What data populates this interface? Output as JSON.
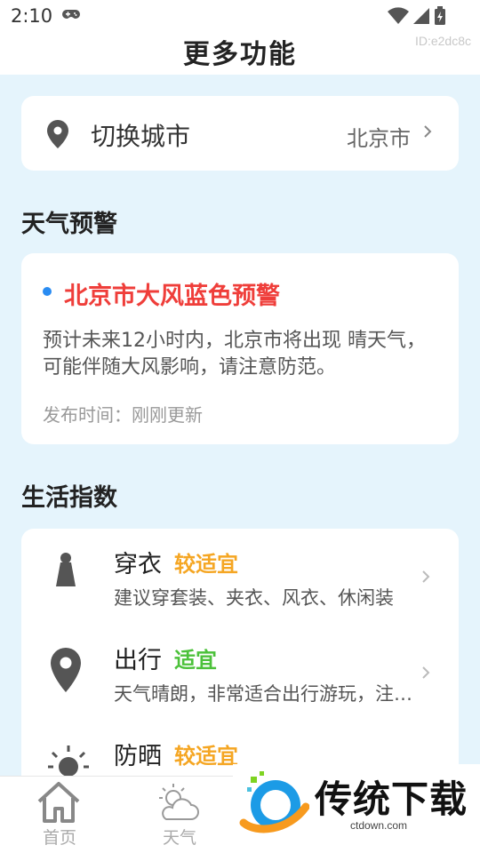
{
  "status_bar": {
    "time": "2:10"
  },
  "header": {
    "title": "更多功能",
    "id_text": "ID:e2dc8c"
  },
  "city": {
    "label": "切换城市",
    "value": "北京市"
  },
  "warning_section": {
    "title": "天气预警",
    "alert_title": "北京市大风蓝色预警",
    "alert_desc": "预计未来12小时内，北京市将出现 晴天气，可能伴随大风影响，请注意防范。",
    "publish_time": "发布时间：刚刚更新"
  },
  "life_section": {
    "title": "生活指数",
    "items": [
      {
        "name": "穿衣",
        "level": "较适宜",
        "level_color": "#f5a623",
        "desc": "建议穿套装、夹衣、风衣、休闲装",
        "icon": "clothing-icon"
      },
      {
        "name": "出行",
        "level": "适宜",
        "level_color": "#4cc13a",
        "desc": "天气晴朗，非常适合出行游玩，注意防晒",
        "icon": "location-pin-icon"
      },
      {
        "name": "防晒",
        "level": "较适宜",
        "level_color": "#f5a623",
        "desc": "",
        "icon": "sun-icon"
      }
    ]
  },
  "nav": [
    {
      "label": "首页",
      "icon": "home-icon"
    },
    {
      "label": "天气",
      "icon": "weather-icon"
    }
  ],
  "watermark": {
    "text": "传统下载",
    "domain": "ctdown.com"
  }
}
